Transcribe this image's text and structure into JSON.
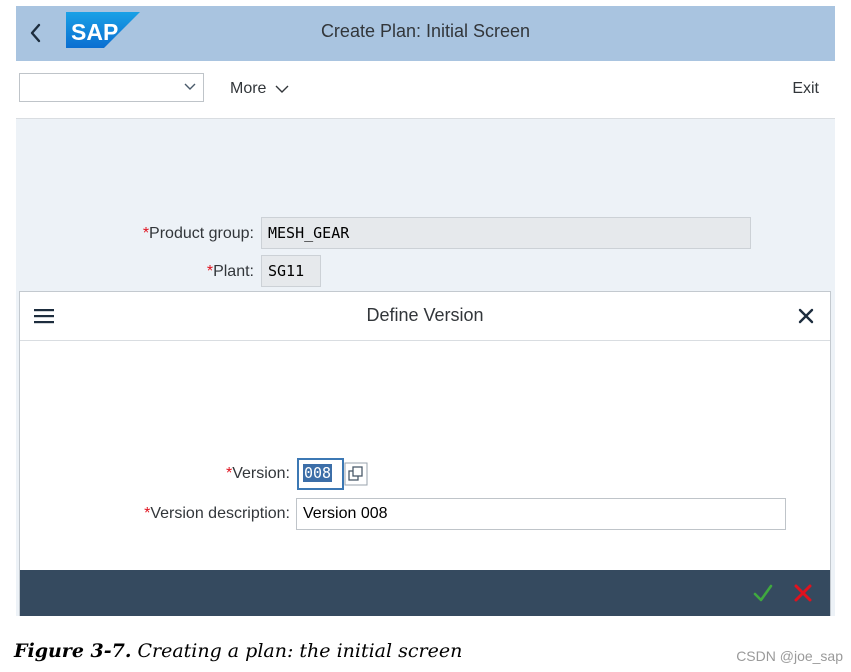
{
  "shell": {
    "title": "Create Plan: Initial Screen",
    "logo_text": "SAP",
    "back_icon": "chevron-left-icon"
  },
  "toolbar": {
    "command_field_value": "",
    "more_label": "More",
    "exit_label": "Exit"
  },
  "form": {
    "product_group_label": "Product group:",
    "product_group_value": "MESH_GEAR",
    "plant_label": "Plant:",
    "plant_value": "SG11"
  },
  "dialog": {
    "title": "Define Version",
    "version_label": "Version:",
    "version_value": "008",
    "version_description_label": "Version description:",
    "version_description_value": "Version 008",
    "confirm_icon": "checkmark-icon",
    "cancel_icon": "red-x-icon"
  },
  "caption": {
    "figure": "Figure 3-7.",
    "text": "Creating a plan: the initial screen"
  },
  "watermark": "CSDN @joe_sap",
  "colors": {
    "shell_bar": "#a9c4e0",
    "background": "#edf2f7",
    "dialog_footer": "#354a5f",
    "required_star": "#e0121e",
    "confirm": "#2b7c2b",
    "cancel": "#e0121e"
  }
}
